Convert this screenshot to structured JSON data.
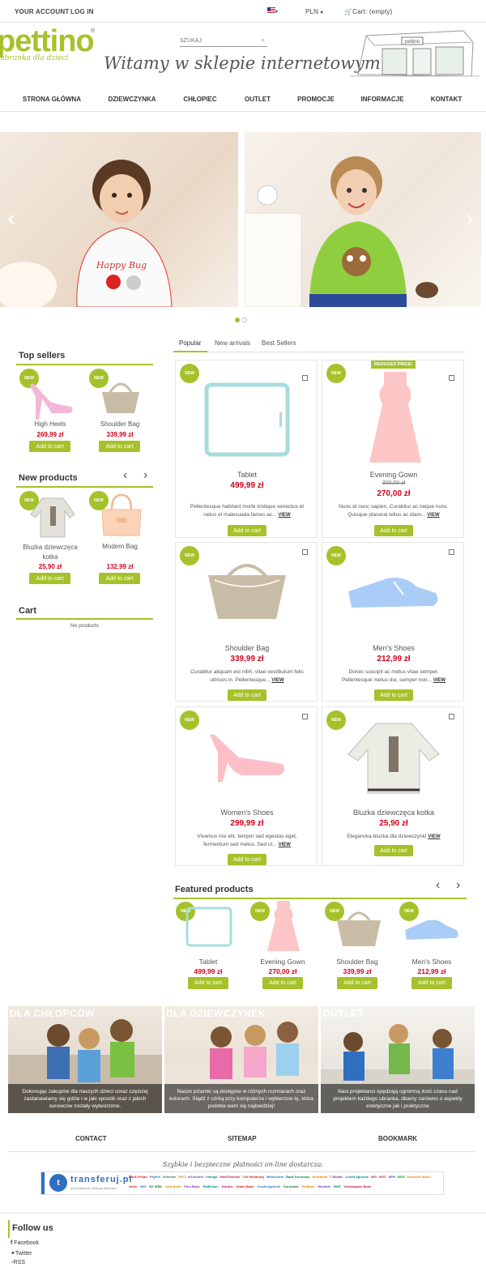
{
  "topbar": {
    "account": "YOUR ACCOUNT",
    "login": "LOG IN",
    "currency": "PLN",
    "cart": "Cart: (empty)"
  },
  "brand": {
    "name": "pettino",
    "tagline": "ubranka dla dzieci",
    "store": "pettino"
  },
  "search": {
    "placeholder": "SZUKAJ"
  },
  "header": {
    "welcome": "Witamy w sklepie internetowym"
  },
  "nav": [
    "STRONA GŁÓWNA",
    "DZIEWCZYNKA",
    "CHŁOPIEC",
    "OUTLET",
    "PROMOCJE",
    "INFORMACJE",
    "KONTAKT"
  ],
  "slider": {
    "left": "‹",
    "right": "›",
    "slide_shirt_text": "Happy Bug"
  },
  "colors": {
    "accent": "#a5c22b",
    "price": "#d0021b"
  },
  "top_sellers": {
    "title": "Top sellers",
    "items": [
      {
        "badge": "NEW",
        "name": "High Heels",
        "price": "269,99 zł",
        "button": "Add to cart"
      },
      {
        "badge": "NEW",
        "name": "Shoulder Bag",
        "price": "339,99 zł",
        "button": "Add to cart"
      }
    ]
  },
  "new_products": {
    "title": "New products",
    "prev": "‹",
    "next": "›",
    "items": [
      {
        "badge": "NEW",
        "name": "Bluzka dziewczęca kotka",
        "price": "25,90 zł",
        "button": "Add to cart"
      },
      {
        "badge": "NEW",
        "name": "Modern Bag",
        "price": "132,99 zł",
        "button": "Add to cart"
      }
    ]
  },
  "cart": {
    "title": "Cart",
    "empty": "No products"
  },
  "tabs": [
    "Popular",
    "New arrivals",
    "Best Sellers"
  ],
  "products": [
    {
      "badge": "NEW",
      "name": "Tablet",
      "price": "499,99 zł",
      "desc1": "Pellentesque habitant morbi tristique senectus et",
      "desc2": "netus et malesuada fames ac...",
      "view": "VIEW",
      "button": "Add to cart"
    },
    {
      "badge": "NEW",
      "flag": "REDUCED PRICE!",
      "name": "Evening Gown",
      "old_price": "300,00 zł",
      "price": "270,00 zł",
      "desc1": "Nunc id nunc sapien. Curabitur ac neque nunc.",
      "desc2": "Quisque placerat tellus ac diam...",
      "view": "VIEW",
      "button": "Add to cart"
    },
    {
      "badge": "NEW",
      "name": "Shoulder Bag",
      "price": "339,99 zł",
      "desc1": "Curabitur aliquam est nibh, vitae vestibulum felis",
      "desc2": "ultrices in. Pellentesque...",
      "view": "VIEW",
      "button": "Add to cart"
    },
    {
      "badge": "NEW",
      "name": "Men's Shoes",
      "price": "212,99 zł",
      "desc1": "Donec suscipit ac metus vitae semper.",
      "desc2": "Pellentesque metus dui, semper non...",
      "view": "VIEW",
      "button": "Add to cart"
    },
    {
      "badge": "NEW",
      "name": "Women's Shoes",
      "price": "299,99 zł",
      "desc1": "Vivamus nisi elit, tempor sed egestas eget,",
      "desc2": "fermentum sed metus. Sed ut...",
      "view": "VIEW",
      "button": "Add to cart"
    },
    {
      "badge": "NEW",
      "name": "Bluzka dziewczęca kotka",
      "price": "25,90 zł",
      "desc1": "Elegancka bluzka dla dziewczynki",
      "desc2": "",
      "view": "VIEW",
      "button": "Add to cart"
    }
  ],
  "featured": {
    "title": "Featured products",
    "prev": "‹",
    "next": "›",
    "items": [
      {
        "badge": "NEW",
        "name": "Tablet",
        "price": "499,99 zł",
        "button": "Add to cart"
      },
      {
        "badge": "NEW",
        "name": "Evening Gown",
        "price": "270,00 zł",
        "button": "Add to cart"
      },
      {
        "badge": "NEW",
        "name": "Shoulder Bag",
        "price": "339,99 zł",
        "button": "Add to cart"
      },
      {
        "badge": "NEW",
        "name": "Men's Shoes",
        "price": "212,99 zł",
        "button": "Add to cart"
      }
    ]
  },
  "categories": [
    {
      "title": "DLA CHŁOPCÓW",
      "caption": "Dokonując zakupów dla naszych dzieci coraz częściej zastanawiamy się gdzie i w jaki sposób oraz z jakich surowców zostały wytworzone."
    },
    {
      "title": "DLA DZIEWCZYNEK",
      "caption": "Nasze piżamki są dostępne w różnych rozmiarach oraz kolorach. Siądź z córką przy komputerze i wybierzcie tę, która podoba wam się najbardziej!"
    },
    {
      "title": "OUTLET",
      "caption": "Nasi projektanci spędzają ogromną ilość czasu nad projektem każdego ubranka, dbamy zarówno o aspekty estetyczne jak i praktyczne"
    }
  ],
  "footer": {
    "contact": "CONTACT",
    "sitemap": "SITEMAP",
    "bookmark": "BOOKMARK",
    "payments_title": "Szybkie i bezpieczne płatności on-line dostarcza:",
    "transferuj": "transferuj.pl",
    "transferuj_sub": "automatyczny obsługa płatności",
    "banks_row1": [
      "Bank Pekao",
      "PayPal",
      "eService",
      "PKO",
      "mTransfer",
      "Inteligo",
      "MultiTransfer",
      "Citi Handlowy",
      "Millennium",
      "Bank Pocztowy",
      "AliorBank",
      "T-Mobile",
      "Credit Agricole",
      "ING",
      "BGŻ",
      "BPH",
      "BOŚ",
      "Deutsche Bank"
    ],
    "banks_row2": [
      "Getin",
      "ING",
      "BZ WBK",
      "Idea Bank",
      "Plus Bank",
      "Raiffeisen",
      "Nordea",
      "Noble Bank",
      "Credit Agricole",
      "Eurobank",
      "PolBank",
      "Meritum",
      "BNP",
      "Volkswagen Bank"
    ],
    "follow_title": "Follow us",
    "facebook": "Facebook",
    "twitter": "Twitter",
    "rss": "RSS"
  }
}
